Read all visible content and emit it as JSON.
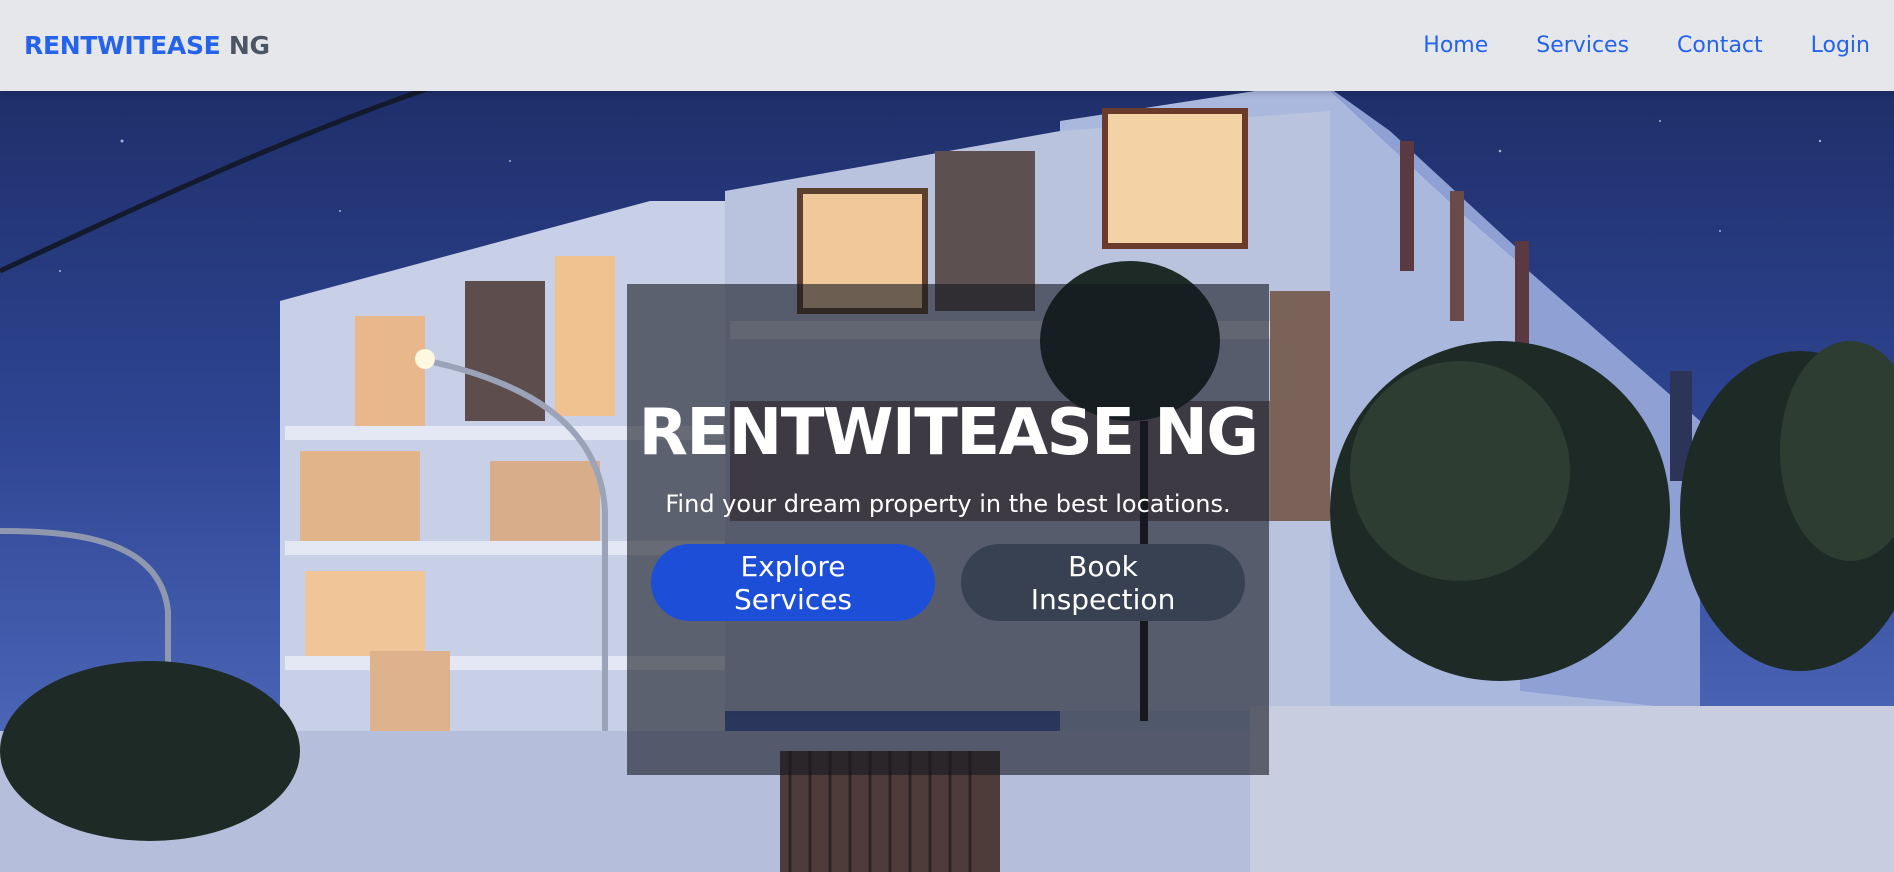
{
  "nav": {
    "brand_primary": "RENTWITEASE",
    "brand_secondary": "NG",
    "links": [
      "Home",
      "Services",
      "Contact",
      "Login"
    ]
  },
  "hero": {
    "title": "RENTWITEASE NG",
    "subtitle": "Find your dream property in the best locations.",
    "primary_button": "Explore Services",
    "secondary_button": "Book Inspection"
  },
  "colors": {
    "brand_blue": "#2563eb",
    "brand_gray": "#4b5563",
    "primary_button": "#1d4ed8",
    "secondary_button": "#374151",
    "navbar_bg": "#e5e7eb"
  }
}
